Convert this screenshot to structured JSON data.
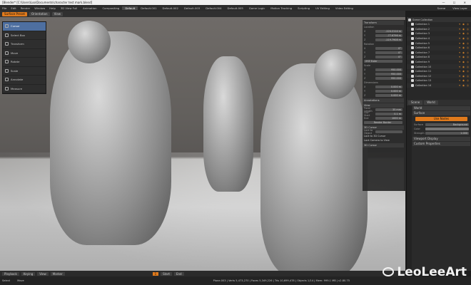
{
  "titlebar": {
    "title": "[Blender* [C:\\Users\\Loo\\Documents\\character test mark.blend]",
    "controls": "— ☐ ✕"
  },
  "menu": {
    "items": [
      "File",
      "Edit",
      "Render",
      "Window",
      "Help"
    ],
    "workspaces": [
      "3D View Full",
      "Animation",
      "Compositing",
      "Default",
      "Default.001",
      "Default.002",
      "Default.003",
      "Default.004",
      "Default.005",
      "Game Logic",
      "Motion Tracking",
      "Scripting",
      "UV Editing",
      "Video Editing"
    ],
    "active_workspace": "Default",
    "scene": "Scene",
    "layer": "View Layer"
  },
  "viewheader": {
    "mode": "Surface Preset",
    "orientation": "Orientation",
    "view": "View"
  },
  "tools": [
    {
      "label": "Cursor",
      "active": true
    },
    {
      "label": "Select Box",
      "active": false
    },
    {
      "label": "Transform",
      "active": false
    },
    {
      "label": "Move",
      "active": false
    },
    {
      "label": "Rotate",
      "active": false
    },
    {
      "label": "Scale",
      "active": false
    },
    {
      "label": "Annotate",
      "active": false
    },
    {
      "label": "Measure",
      "active": false
    }
  ],
  "npanel": {
    "transform": "Transform",
    "location": "Location",
    "loc": [
      "-124.2114 m",
      "-77.6796 m",
      "-119.7908 m"
    ],
    "rotation": "Rotation",
    "rot": [
      "0°",
      "0°",
      "0°"
    ],
    "mode": "XYZ Euler",
    "scale": "Scale",
    "sc": [
      "950.000",
      "950.000",
      "950.000"
    ],
    "dimensions": "Dimensions",
    "dim": [
      "0.000 m",
      "0.000 m",
      "0.000 m"
    ],
    "annotations": "Annotations",
    "view": "View",
    "focal_label": "Focal Length",
    "focal": "35 mm",
    "clip_start_label": "Clip Start",
    "clip_start": "0.1 m",
    "clip_end_label": "End",
    "clip_end": "1000 m",
    "render_border": "Render Border",
    "cursor3d": "3D Cursor",
    "lock_label": "Lock to Object",
    "lock_cursor": "Lock to 3D Cursor",
    "lock_camera": "Lock Camera to View",
    "cursor": "3D Cursor"
  },
  "outliner": {
    "header": "Scene Collection",
    "collections": [
      "Collection 1",
      "Collection 2",
      "Collection 3",
      "Collection 4",
      "Collection 5",
      "Collection 6",
      "Collection 7",
      "Collection 8",
      "Collection 9",
      "Collection 10",
      "Collection 11",
      "Collection 12",
      "Collection 13",
      "Collection 14"
    ]
  },
  "props": {
    "tabs": [
      "Scene",
      "World"
    ],
    "world": "World",
    "surface_section": "Surface",
    "use_nodes": "Use Nodes",
    "surface_label": "Surface",
    "surface_value": "Background",
    "color_label": "Color",
    "strength_label": "Strength",
    "strength_value": "1.000",
    "viewport_display": "Viewport Display",
    "custom_props": "Custom Properties"
  },
  "timeline": {
    "playback": "Playback",
    "keying": "Keying",
    "view": "View",
    "marker": "Marker",
    "frame": "1",
    "start": "Start",
    "end": "End"
  },
  "status": {
    "left": "Select",
    "center": "Move",
    "right": "Plane.003 | Verts 5,473,270 | Faces 5,349,226 | Tris 10,699,478 | Objects 1/14 | Mem: 999.1 MB | v2.80.75"
  },
  "watermark": "LeoLeeArt",
  "colors": {
    "accent": "#e07a1c",
    "active_tool": "#4e6fa0"
  }
}
